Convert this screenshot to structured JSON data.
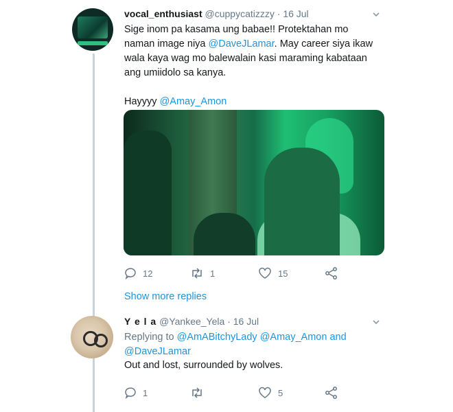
{
  "tweet1": {
    "display_name": "vocal_enthusiast",
    "handle": "@cuppycatizzzy",
    "separator": "·",
    "date": "16 Jul",
    "lines": [
      "Sige inom pa kasama ung babae!! Protektahan mo",
      "naman image niya ",
      "@DaveJLamar",
      ". May career siya ikaw",
      "wala kaya wag mo balewalain kasi maraming kabataan",
      "ang umiidolo sa kanya."
    ],
    "second_para_prefix": "Hayyyy ",
    "second_para_mention": "@Amay_Amon",
    "counts": {
      "replies": "12",
      "retweets": "1",
      "likes": "15"
    }
  },
  "show_more": "Show more replies",
  "tweet2": {
    "display_name": "Y e l a",
    "handle": "@Yankee_Yela",
    "separator": "·",
    "date": "16 Jul",
    "replying_to_label": "Replying to ",
    "replying_mention1": "@AmABitchyLady",
    "replying_mention2": "@Amay_Amon",
    "replying_and": " and",
    "replying_mention3": "@DaveJLamar",
    "text": "Out and lost, surrounded by wolves.",
    "counts": {
      "replies": "1",
      "likes": "5"
    }
  },
  "colors": {
    "link": "#1b95e0",
    "muted": "#657786",
    "thread_line": "#c7d2da"
  },
  "icons": [
    "reply-icon",
    "retweet-icon",
    "like-icon",
    "share-icon",
    "chevron-down-icon"
  ]
}
